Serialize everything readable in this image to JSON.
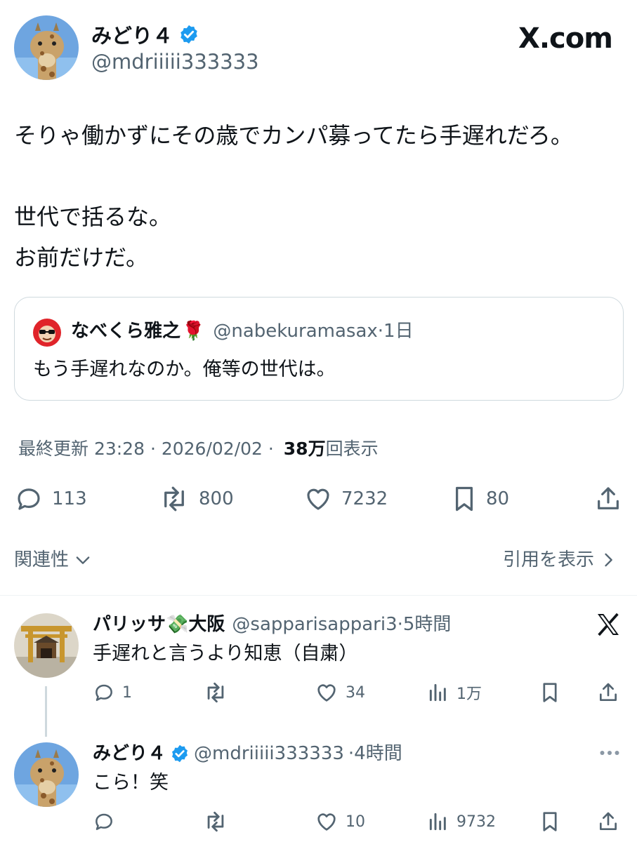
{
  "main_tweet": {
    "display_name": "みどり４",
    "handle": "@mdriiiii333333",
    "text_lines": [
      "そりゃ働かずにその歳でカンパ募ってたら手遅れだろ。",
      "",
      "世代で括るな。",
      "お前だけだ。"
    ],
    "quoted": {
      "display_name": "なべくら雅之",
      "name_emoji": "🌹",
      "handle": "@nabekuramasax",
      "time": "·1日",
      "text": "もう手遅れなのか。俺等の世代は。"
    },
    "meta": {
      "prefix": "最終更新 23:28 · 2026/02/02 ·",
      "views_count": "38万",
      "views_label": "回表示"
    },
    "actions": {
      "replies": "113",
      "retweets": "800",
      "likes": "7232",
      "bookmarks": "80"
    }
  },
  "brand": {
    "label": "X.com"
  },
  "filter_bar": {
    "relevance_label": "関連性",
    "quotes_label": "引用を表示"
  },
  "replies": [
    {
      "display_name": "パリッサ",
      "name_emoji": "💸",
      "name_suffix": "大阪",
      "handle": "@sapparisappari3",
      "time": "·5時間",
      "text": "手遅れと言うより知恵（自粛）",
      "replies": "1",
      "retweets": "",
      "likes": "34",
      "views": "1万"
    },
    {
      "display_name": "みどり４",
      "handle": "@mdriiiii333333",
      "time": "·4時間",
      "text": "こら！笑",
      "replies": "",
      "retweets": "",
      "likes": "10",
      "views": "9732"
    }
  ],
  "colors": {
    "text": "#0f1419",
    "muted": "#536471",
    "verified": "#1d9bf0",
    "border": "#cfd9de"
  }
}
